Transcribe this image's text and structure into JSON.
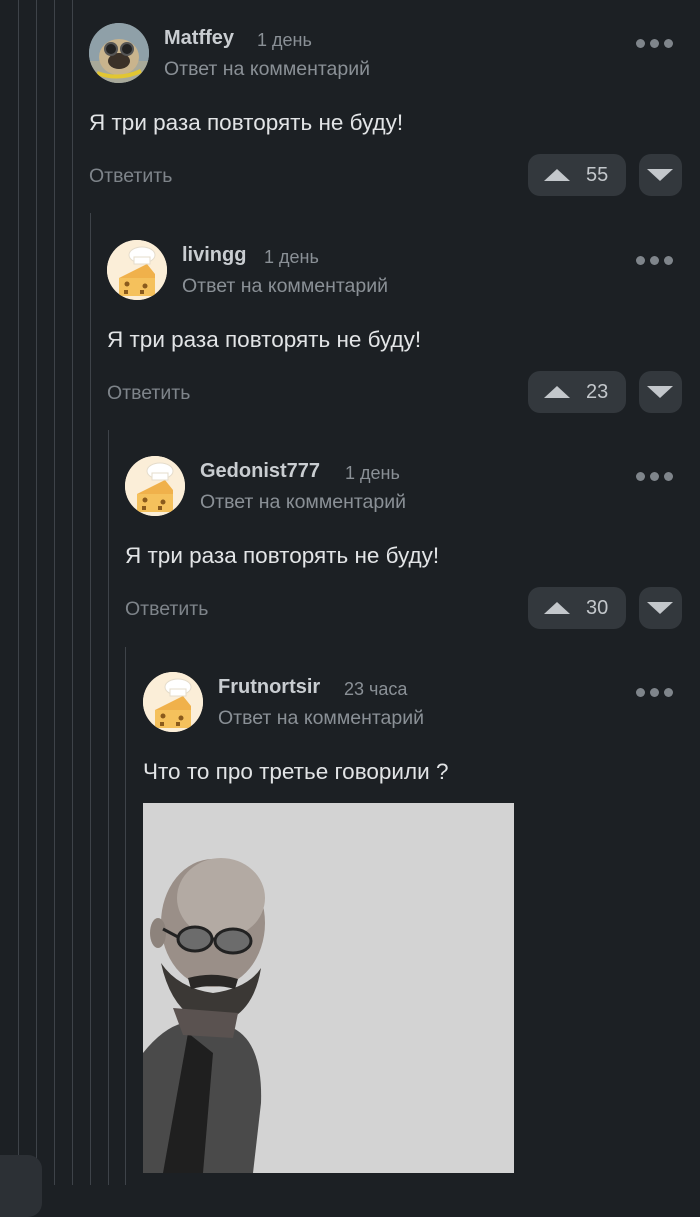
{
  "comments": [
    {
      "username": "Matffey",
      "time": "1 день",
      "reply_note": "Ответ на комментарий",
      "text": "Я три раза повторять не буду!",
      "reply_label": "Ответить",
      "votes": "55",
      "avatar": "pug-avatar"
    },
    {
      "username": "livingg",
      "time": "1 день",
      "reply_note": "Ответ на комментарий",
      "text": "Я три раза повторять не буду!",
      "reply_label": "Ответить",
      "votes": "23",
      "avatar": "chef-cheese-avatar"
    },
    {
      "username": "Gedonist777",
      "time": "1 день",
      "reply_note": "Ответ на комментарий",
      "text": "Я три раза повторять не буду!",
      "reply_label": "Ответить",
      "votes": "30",
      "avatar": "chef-cheese-avatar"
    },
    {
      "username": "Frutnortsir",
      "time": "23 часа",
      "reply_note": "Ответ на комментарий",
      "text": "Что то про третье говорили ?",
      "avatar": "chef-cheese-avatar",
      "image": "grayscale-photo-man-with-glasses"
    }
  ],
  "colors": {
    "background": "#1c2024",
    "button_bg": "#33383d",
    "avatar_bg": "#fbeed8",
    "muted_text": "#8a9096"
  }
}
